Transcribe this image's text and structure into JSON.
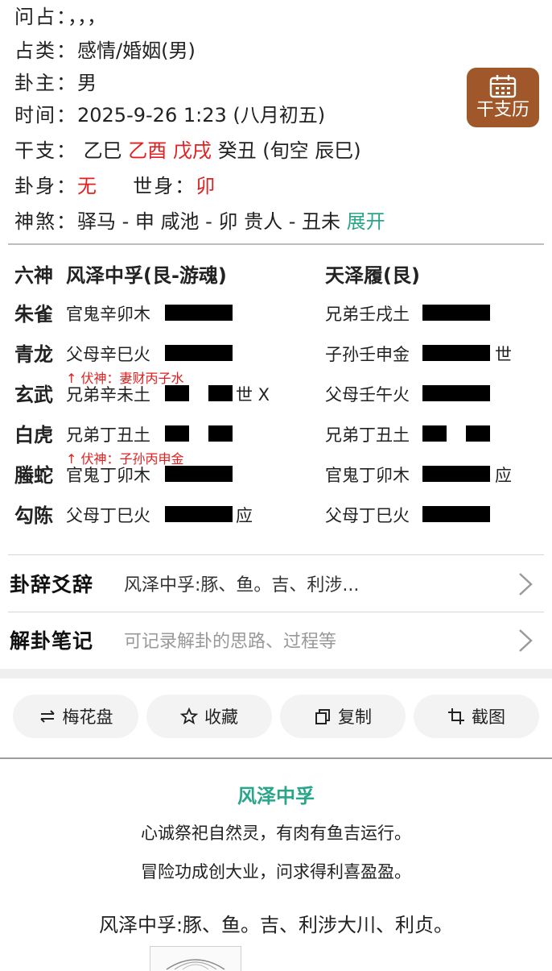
{
  "info": {
    "wen_zhan": {
      "label": "问占：",
      "value": "，，，"
    },
    "zhan_lei": {
      "label": "占类：",
      "value": "感情/婚姻(男)"
    },
    "gua_zhu": {
      "label": "卦主：",
      "value": "男"
    },
    "shi_jian": {
      "label": "时间：",
      "value": "2025-9-26 1:23 (八月初五)"
    },
    "gan_zhi": {
      "label": "干支：",
      "year": "乙巳",
      "month_day": "乙酉 戊戌",
      "hour": "癸丑",
      "xun_kong": "(旬空 辰巳)"
    },
    "gua_shen": {
      "label": "卦身：",
      "value": "无",
      "shi_shen_label": "世身：",
      "shi_shen_value": "卯"
    },
    "shen_sha": {
      "label": "神煞：",
      "value": "驿马 - 申 咸池 - 卯 贵人 - 丑未",
      "expand": "展开"
    }
  },
  "calendar_button": {
    "label": "干支历",
    "icon": "calendar-icon"
  },
  "hexagram": {
    "col_head": "六神",
    "main_name": "风泽中孚(艮-游魂)",
    "changed_name": "天泽履(艮)",
    "rows": [
      {
        "shen": "朱雀",
        "main": "官鬼辛卯木",
        "main_yin": false,
        "main_mark": "",
        "changed": "兄弟壬戌土",
        "changed_yin": false,
        "changed_mark": ""
      },
      {
        "shen": "青龙",
        "main": "父母辛巳火",
        "main_yin": false,
        "main_mark": "",
        "changed": "子孙壬申金",
        "changed_yin": false,
        "changed_mark": "世"
      },
      {
        "shen": "玄武",
        "main": "兄弟辛未土",
        "main_yin": true,
        "main_mark": "世 X",
        "changed": "父母壬午火",
        "changed_yin": false,
        "changed_mark": ""
      },
      {
        "shen": "白虎",
        "main": "兄弟丁丑土",
        "main_yin": true,
        "main_mark": "",
        "changed": "兄弟丁丑土",
        "changed_yin": true,
        "changed_mark": ""
      },
      {
        "shen": "螣蛇",
        "main": "官鬼丁卯木",
        "main_yin": false,
        "main_mark": "",
        "changed": "官鬼丁卯木",
        "changed_yin": false,
        "changed_mark": "应"
      },
      {
        "shen": "勾陈",
        "main": "父母丁巳火",
        "main_yin": false,
        "main_mark": "应",
        "changed": "父母丁巳火",
        "changed_yin": false,
        "changed_mark": ""
      }
    ],
    "fushen": [
      "↑ 伏神：妻财丙子水",
      "↑ 伏神：子孙丙申金"
    ]
  },
  "sections": {
    "gua_ci": {
      "title": "卦辞爻辞",
      "text": "风泽中孚:豚、鱼。吉、利涉..."
    },
    "notes": {
      "title": "解卦笔记",
      "placeholder": "可记录解卦的思路、过程等"
    }
  },
  "buttons": {
    "meihua": "梅花盘",
    "favorite": "收藏",
    "copy": "复制",
    "screenshot": "截图"
  },
  "description": {
    "title": "风泽中孚",
    "poem_line1": "心诚祭祀自然灵，有肉有鱼吉运行。",
    "poem_line2": "冒险功成创大业，问求得利喜盈盈。",
    "gua_ci_full": "风泽中孚:豚、鱼。吉、利涉大川、利贞。"
  },
  "colors": {
    "accent_red": "#e02020",
    "accent_green": "#2aa58a",
    "calendar_brown": "#a0582a"
  }
}
